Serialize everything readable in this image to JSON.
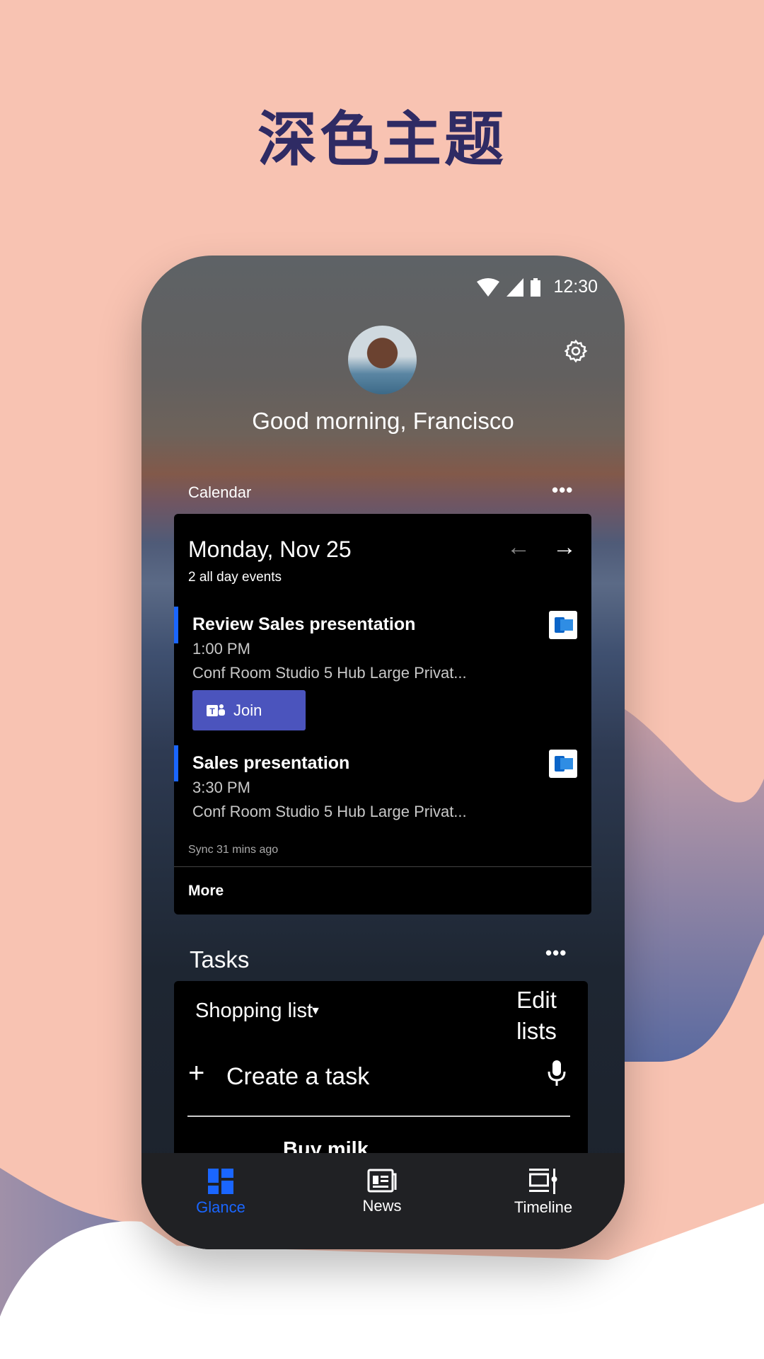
{
  "headline": "深色主题",
  "status": {
    "time": "12:30",
    "icons": [
      "wifi-icon",
      "signal-icon",
      "battery-icon"
    ]
  },
  "greeting": "Good morning, Francisco",
  "calendar": {
    "label": "Calendar",
    "date": "Monday, Nov 25",
    "all_day": "2 all day events",
    "events": [
      {
        "title": "Review Sales presentation",
        "time": "1:00 PM",
        "location": "Conf Room Studio 5 Hub Large Privat...",
        "join_label": "Join"
      },
      {
        "title": "Sales presentation",
        "time": "3:30 PM",
        "location": "Conf Room Studio 5 Hub Large Privat..."
      }
    ],
    "sync": "Sync 31 mins ago",
    "more": "More"
  },
  "tasks": {
    "label": "Tasks",
    "list_name": "Shopping list",
    "edit_line1": "Edit",
    "edit_line2": "lists",
    "create_placeholder": "Create a task",
    "items": [
      "Buy milk"
    ]
  },
  "nav": [
    {
      "label": "Glance",
      "active": true
    },
    {
      "label": "News",
      "active": false
    },
    {
      "label": "Timeline",
      "active": false
    }
  ],
  "colors": {
    "accent": "#1a66ff",
    "join": "#4b54bd",
    "headline": "#2f2b64",
    "background": "#f8c3b2"
  }
}
